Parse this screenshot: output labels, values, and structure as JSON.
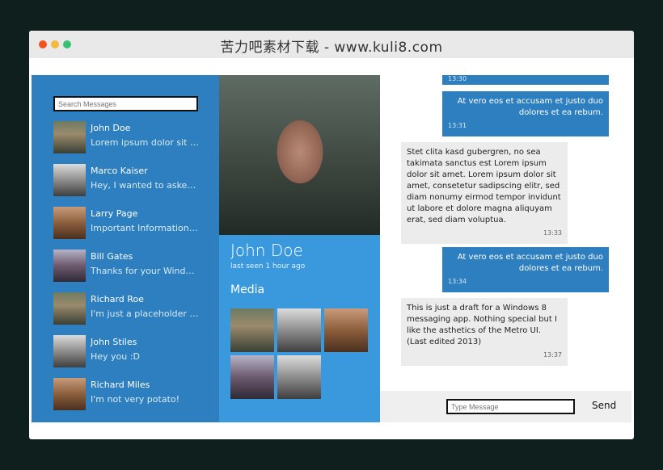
{
  "window": {
    "title": "苦力吧素材下载 - www.kuli8.com"
  },
  "contacts": {
    "search_placeholder": "Search Messages",
    "items": [
      {
        "name": "John Doe",
        "preview": "Lorem ipsum dolor sit am..."
      },
      {
        "name": "Marco Kaiser",
        "preview": "Hey, I wanted to asked yo..."
      },
      {
        "name": "Larry Page",
        "preview": "Important Information: W..."
      },
      {
        "name": "Bill Gates",
        "preview": "Thanks for your Windows ..."
      },
      {
        "name": "Richard Roe",
        "preview": "I'm just a placeholder text"
      },
      {
        "name": "John Stiles",
        "preview": "Hey you :D"
      },
      {
        "name": "Richard Miles",
        "preview": "I'm not very potato!"
      }
    ]
  },
  "profile": {
    "name": "John Doe",
    "last_seen": "last seen 1 hour ago",
    "media_heading": "Media"
  },
  "chat": {
    "messages": [
      {
        "direction": "out",
        "text": "",
        "time": "13:30"
      },
      {
        "direction": "out",
        "text": "At vero eos et accusam et justo duo dolores et ea rebum.",
        "time": "13:31"
      },
      {
        "direction": "in",
        "text": "Stet clita kasd gubergren, no sea takimata sanctus est Lorem ipsum dolor sit amet. Lorem ipsum dolor sit amet, consetetur sadipscing elitr, sed diam nonumy eirmod tempor invidunt ut labore et dolore magna aliquyam erat, sed diam voluptua.",
        "time": "13:33"
      },
      {
        "direction": "out",
        "text": "At vero eos et accusam et justo duo dolores et ea rebum.",
        "time": "13:34"
      },
      {
        "direction": "in",
        "text": "This is just a draft for a Windows 8 messaging app. Nothing special but I like the asthetics of the Metro UI. (Last edited 2013)",
        "time": "13:37"
      }
    ],
    "input_placeholder": "Type Message",
    "send_label": "Send"
  }
}
